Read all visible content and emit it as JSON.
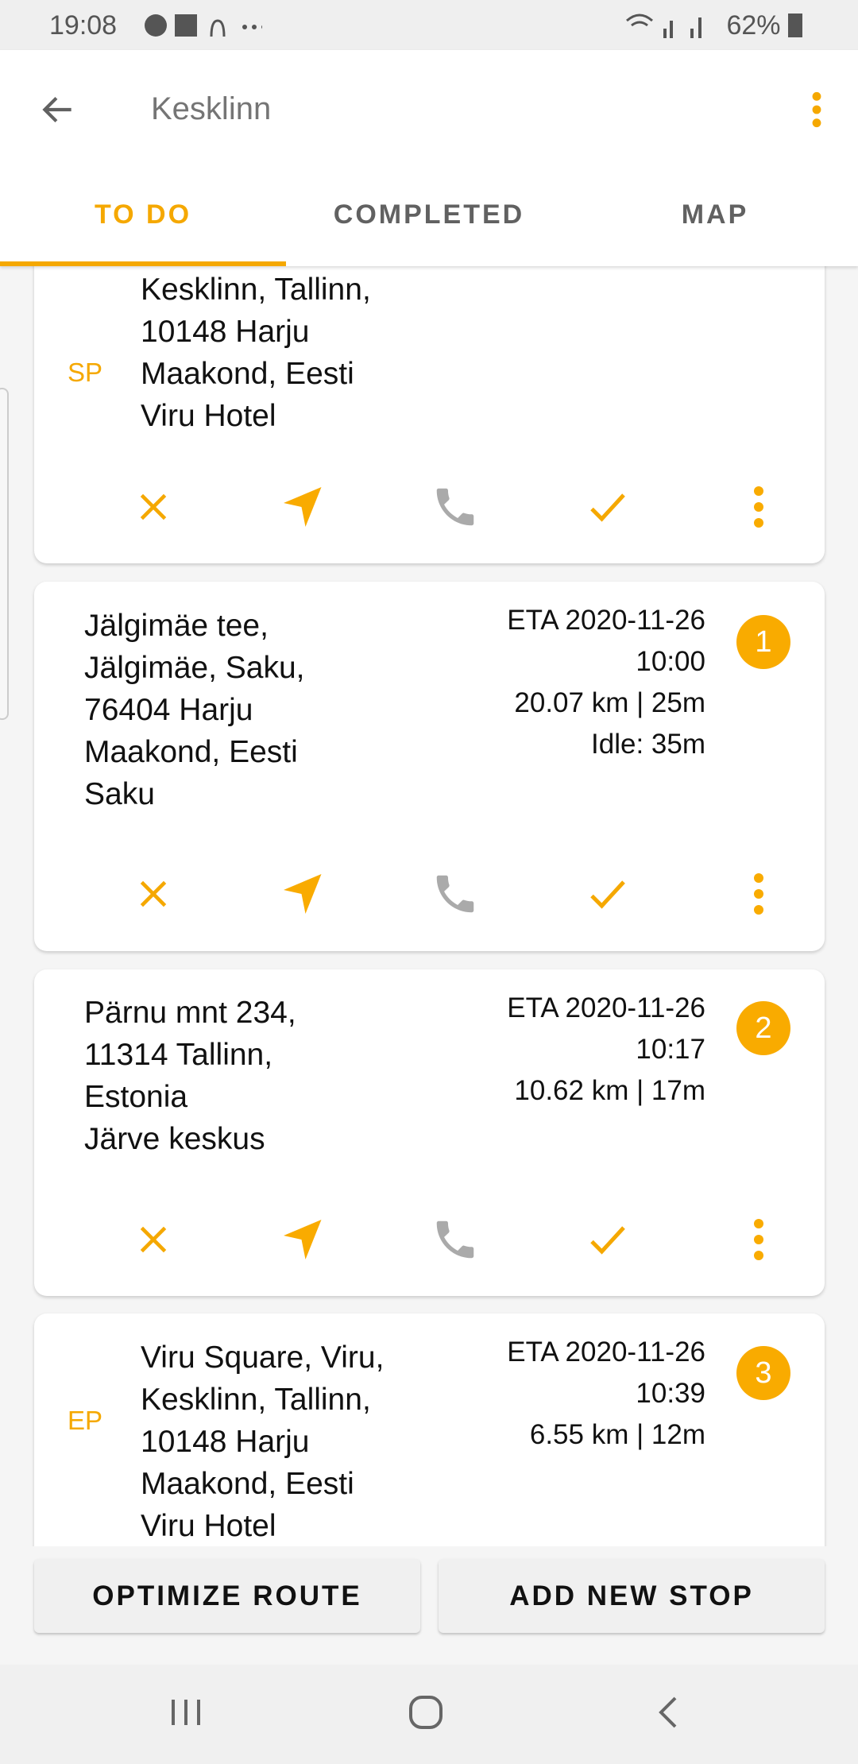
{
  "status_bar": {
    "time": "19:08",
    "battery": "62%"
  },
  "app_bar": {
    "title": "Kesklinn"
  },
  "tabs": [
    {
      "label": "TO DO",
      "active": true
    },
    {
      "label": "COMPLETED",
      "active": false
    },
    {
      "label": "MAP",
      "active": false
    }
  ],
  "colors": {
    "accent": "#F5A800",
    "icon_gray": "#AAAAAA"
  },
  "stops": [
    {
      "tag": "SP",
      "address_lines": [
        "Kesklinn, Tallinn,",
        "10148 Harju",
        "Maakond, Eesti",
        "Viru Hotel"
      ]
    },
    {
      "address_lines": [
        "Jälgimäe tee,",
        "Jälgimäe, Saku,",
        "76404 Harju",
        "Maakond, Eesti",
        "Saku"
      ],
      "eta_lines": [
        "ETA 2020-11-26",
        "10:00",
        "20.07 km | 25m",
        "Idle: 35m"
      ],
      "number": "1"
    },
    {
      "address_lines": [
        "Pärnu mnt 234,",
        "11314 Tallinn,",
        "Estonia",
        "Järve keskus"
      ],
      "eta_lines": [
        "ETA 2020-11-26",
        "10:17",
        "10.62 km | 17m"
      ],
      "number": "2"
    },
    {
      "tag": "EP",
      "address_lines": [
        "Viru Square, Viru,",
        "Kesklinn, Tallinn,",
        "10148 Harju",
        "Maakond, Eesti",
        "Viru Hotel"
      ],
      "eta_lines": [
        "ETA 2020-11-26",
        "10:39",
        "6.55 km | 12m"
      ],
      "number": "3"
    }
  ],
  "buttons": {
    "optimize": "OPTIMIZE ROUTE",
    "add_stop": "ADD NEW STOP"
  }
}
